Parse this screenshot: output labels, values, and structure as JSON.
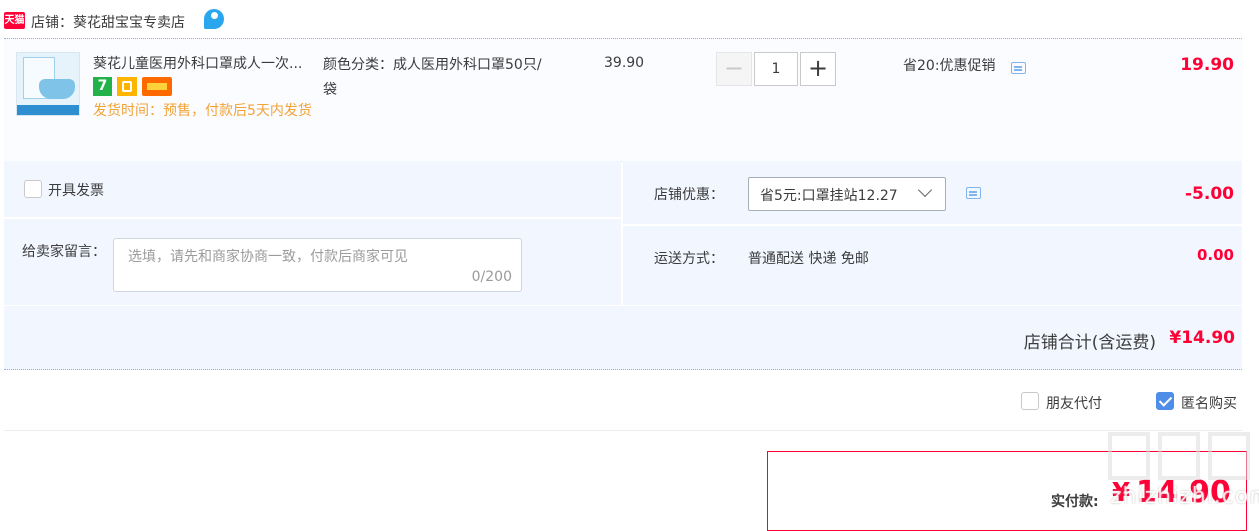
{
  "shop": {
    "badge": "天猫",
    "name_line": "店铺：葵花甜宝宝专卖店"
  },
  "item": {
    "title": "葵花儿童医用外科口罩成人一次...",
    "ship_time": "发货时间：预售，付款后5天内发货",
    "badge_7": "7",
    "sku": "颜色分类：成人医用外科口罩50只/袋",
    "unit_price": "39.90",
    "quantity": "1",
    "qty_minus": "−",
    "qty_plus": "+",
    "promo": "省20:优惠促销",
    "subtotal": "19.90"
  },
  "options": {
    "invoice_label": "开具发票",
    "remark_label": "给卖家留言：",
    "remark_placeholder": "选填，请先和商家协商一致，付款后商家可见",
    "remark_count": "0/200",
    "shop_coupon_label": "店铺优惠：",
    "shop_coupon_selected": "省5元:口罩挂站12.27",
    "shop_coupon_amount": "-5.00",
    "shipping_label": "运送方式：",
    "shipping_method": "普通配送 快递 免邮",
    "shipping_fee": "0.00"
  },
  "shop_total": {
    "label": "店铺合计(含运费)",
    "value": "¥14.90"
  },
  "extras": {
    "friend_pay_label": "朋友代付",
    "friend_pay_checked": false,
    "anonymous_label": "匿名购买",
    "anonymous_checked": true
  },
  "payment": {
    "label": "实付款:",
    "currency": "¥",
    "amount": "14.90"
  },
  "watermark": {
    "text": "zhizhizhi.com"
  },
  "colors": {
    "price_red": "#ff0036",
    "accent_blue": "#4e8ee8",
    "panel_bg": "#f2f7ff",
    "ship_orange": "#f1a337"
  }
}
